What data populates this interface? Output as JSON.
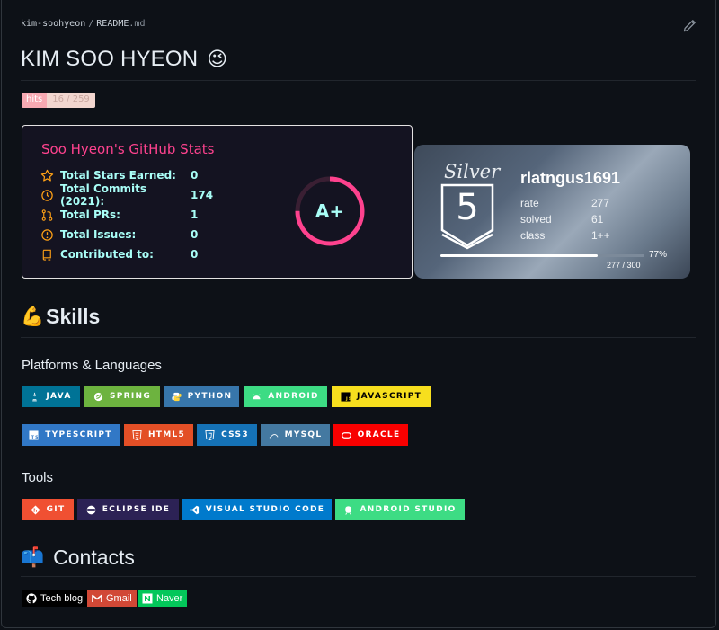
{
  "breadcrumb": {
    "user": "kim-soohyeon",
    "separator": "/",
    "file": "README",
    "ext": ".md"
  },
  "title": {
    "text": "KIM SOO HYEON",
    "emoji": "😉"
  },
  "hits_badge": {
    "label": "hits",
    "value": "16 / 259"
  },
  "github_stats": {
    "title": "Soo Hyeon's GitHub Stats",
    "rows": [
      {
        "icon": "star-icon",
        "label": "Total Stars Earned:",
        "value": "0"
      },
      {
        "icon": "history-icon",
        "label": "Total Commits (2021):",
        "value": "174"
      },
      {
        "icon": "pull-request-icon",
        "label": "Total PRs:",
        "value": "1"
      },
      {
        "icon": "issue-icon",
        "label": "Total Issues:",
        "value": "0"
      },
      {
        "icon": "repo-icon",
        "label": "Contributed to:",
        "value": "0"
      }
    ],
    "grade": "A+",
    "grade_fill": 0.75
  },
  "solved_card": {
    "tier": "Silver",
    "tier_level": "5",
    "handle": "rlatngus1691",
    "info": [
      {
        "key": "rate",
        "value": "277"
      },
      {
        "key": "solved",
        "value": "61"
      },
      {
        "key": "class",
        "value": "1++"
      }
    ],
    "progress_fraction": 0.77,
    "progress_percent": "77%",
    "progress_text": "277 / 300"
  },
  "skills": {
    "heading": "Skills",
    "heading_emoji": "💪",
    "platforms_heading": "Platforms & Languages",
    "platforms": [
      {
        "label": "JAVA",
        "icon": "java-icon",
        "color": "#007396"
      },
      {
        "label": "SPRING",
        "icon": "spring-icon",
        "color": "#6db33f"
      },
      {
        "label": "PYTHON",
        "icon": "python-icon",
        "color": "#3776ab"
      },
      {
        "label": "ANDROID",
        "icon": "android-icon",
        "color": "#3ddc84"
      },
      {
        "label": "JAVASCRIPT",
        "icon": "javascript-icon",
        "color": "#f7df1e"
      },
      {
        "label": "TYPESCRIPT",
        "icon": "typescript-icon",
        "color": "#3178c6"
      },
      {
        "label": "HTML5",
        "icon": "html5-icon",
        "color": "#e34f26"
      },
      {
        "label": "CSS3",
        "icon": "css3-icon",
        "color": "#1572b6"
      },
      {
        "label": "MYSQL",
        "icon": "mysql-icon",
        "color": "#4479a1"
      },
      {
        "label": "ORACLE",
        "icon": "oracle-icon",
        "color": "#f80000"
      }
    ],
    "tools_heading": "Tools",
    "tools": [
      {
        "label": "GIT",
        "icon": "git-icon",
        "color": "#f05032"
      },
      {
        "label": "ECLIPSE IDE",
        "icon": "eclipse-icon",
        "color": "#2c2255"
      },
      {
        "label": "VISUAL STUDIO CODE",
        "icon": "vscode-icon",
        "color": "#007acc"
      },
      {
        "label": "ANDROID STUDIO",
        "icon": "android-studio-icon",
        "color": "#3ddc84"
      }
    ]
  },
  "contacts": {
    "heading": "Contacts",
    "heading_emoji": "📫",
    "badges": [
      {
        "label": "Tech blog",
        "icon": "github-icon",
        "color": "#000000"
      },
      {
        "label": "Gmail",
        "icon": "gmail-icon",
        "color": "#d14836"
      },
      {
        "label": "Naver",
        "icon": "naver-icon",
        "color": "#03c75a"
      }
    ]
  }
}
